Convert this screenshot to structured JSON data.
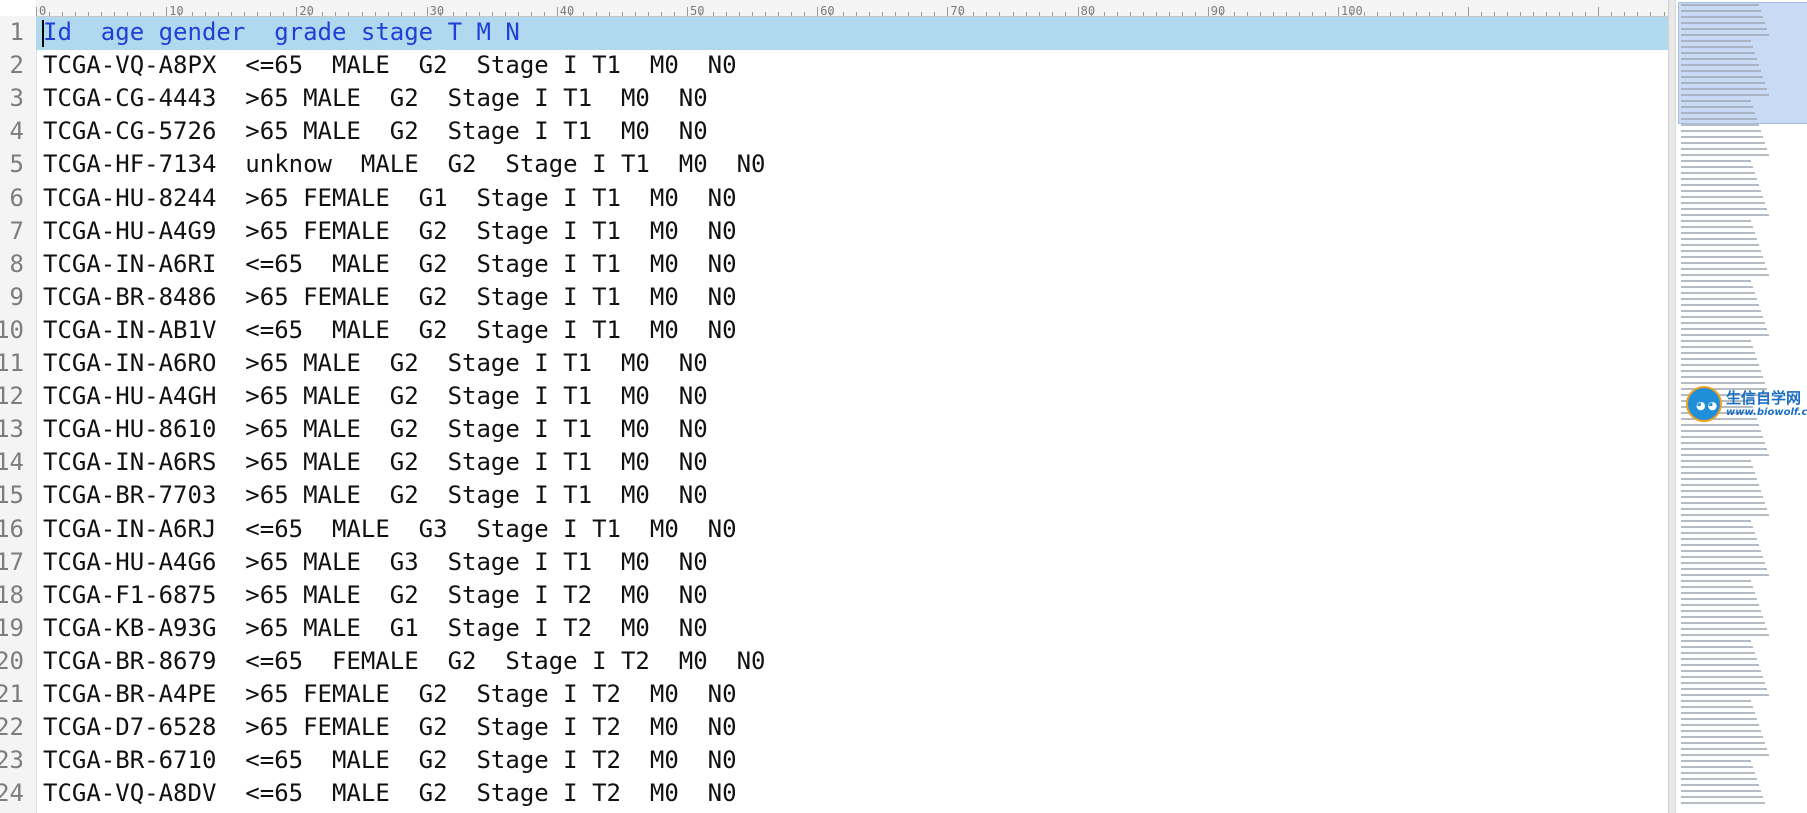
{
  "ruler": {
    "labels": [
      "0",
      "10",
      "20",
      "30",
      "40",
      "50",
      "60",
      "70",
      "80",
      "90",
      "100"
    ]
  },
  "editor": {
    "lines": [
      {
        "num": "1",
        "text": "Id  age gender  grade stage T M N"
      },
      {
        "num": "2",
        "text": "TCGA-VQ-A8PX  <=65  MALE  G2  Stage I T1  M0  N0"
      },
      {
        "num": "3",
        "text": "TCGA-CG-4443  >65 MALE  G2  Stage I T1  M0  N0"
      },
      {
        "num": "4",
        "text": "TCGA-CG-5726  >65 MALE  G2  Stage I T1  M0  N0"
      },
      {
        "num": "5",
        "text": "TCGA-HF-7134  unknow  MALE  G2  Stage I T1  M0  N0"
      },
      {
        "num": "6",
        "text": "TCGA-HU-8244  >65 FEMALE  G1  Stage I T1  M0  N0"
      },
      {
        "num": "7",
        "text": "TCGA-HU-A4G9  >65 FEMALE  G2  Stage I T1  M0  N0"
      },
      {
        "num": "8",
        "text": "TCGA-IN-A6RI  <=65  MALE  G2  Stage I T1  M0  N0"
      },
      {
        "num": "9",
        "text": "TCGA-BR-8486  >65 FEMALE  G2  Stage I T1  M0  N0"
      },
      {
        "num": "10",
        "text": "TCGA-IN-AB1V  <=65  MALE  G2  Stage I T1  M0  N0"
      },
      {
        "num": "11",
        "text": "TCGA-IN-A6RO  >65 MALE  G2  Stage I T1  M0  N0"
      },
      {
        "num": "12",
        "text": "TCGA-HU-A4GH  >65 MALE  G2  Stage I T1  M0  N0"
      },
      {
        "num": "13",
        "text": "TCGA-HU-8610  >65 MALE  G2  Stage I T1  M0  N0"
      },
      {
        "num": "14",
        "text": "TCGA-IN-A6RS  >65 MALE  G2  Stage I T1  M0  N0"
      },
      {
        "num": "15",
        "text": "TCGA-BR-7703  >65 MALE  G2  Stage I T1  M0  N0"
      },
      {
        "num": "16",
        "text": "TCGA-IN-A6RJ  <=65  MALE  G3  Stage I T1  M0  N0"
      },
      {
        "num": "17",
        "text": "TCGA-HU-A4G6  >65 MALE  G3  Stage I T1  M0  N0"
      },
      {
        "num": "18",
        "text": "TCGA-F1-6875  >65 MALE  G2  Stage I T2  M0  N0"
      },
      {
        "num": "19",
        "text": "TCGA-KB-A93G  >65 MALE  G1  Stage I T2  M0  N0"
      },
      {
        "num": "20",
        "text": "TCGA-BR-8679  <=65  FEMALE  G2  Stage I T2  M0  N0"
      },
      {
        "num": "21",
        "text": "TCGA-BR-A4PE  >65 FEMALE  G2  Stage I T2  M0  N0"
      },
      {
        "num": "22",
        "text": "TCGA-D7-6528  >65 FEMALE  G2  Stage I T2  M0  N0"
      },
      {
        "num": "23",
        "text": "TCGA-BR-6710  <=65  MALE  G2  Stage I T2  M0  N0"
      },
      {
        "num": "24",
        "text": "TCGA-VQ-A8DV  <=65  MALE  G2  Stage I T2  M0  N0"
      }
    ]
  },
  "watermark": {
    "name": "生信自学网",
    "url": "www.biowolf.cn"
  },
  "colors": {
    "active_line_bg": "#b0d8ee",
    "active_line_text": "#1f3fd6",
    "logo_blue": "#1b6fc4"
  }
}
